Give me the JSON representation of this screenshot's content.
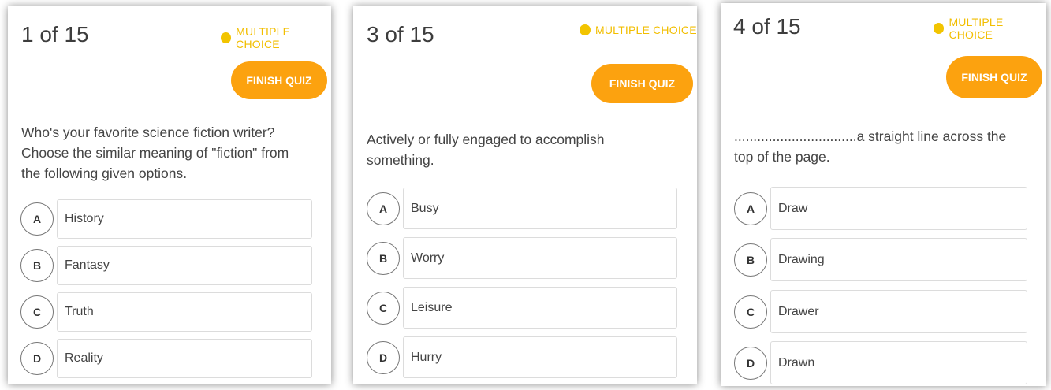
{
  "cards": [
    {
      "counter": "1 of 15",
      "badge": "MULTIPLE CHOICE",
      "finish_label": "FINISH QUIZ",
      "question_lines": [
        "Who's your favorite science fiction writer?",
        "Choose the similar meaning of \"fiction\" from",
        "the following given options."
      ],
      "options": [
        {
          "letter": "A",
          "text": "History"
        },
        {
          "letter": "B",
          "text": "Fantasy"
        },
        {
          "letter": "C",
          "text": "Truth"
        },
        {
          "letter": "D",
          "text": "Reality"
        }
      ]
    },
    {
      "counter": "3 of 15",
      "badge": "MULTIPLE CHOICE",
      "finish_label": "FINISH QUIZ",
      "question_lines": [
        "Actively or fully engaged to accomplish",
        "something."
      ],
      "options": [
        {
          "letter": "A",
          "text": "Busy"
        },
        {
          "letter": "B",
          "text": "Worry"
        },
        {
          "letter": "C",
          "text": "Leisure"
        },
        {
          "letter": "D",
          "text": "Hurry"
        }
      ]
    },
    {
      "counter": "4 of 15",
      "badge": "MULTIPLE CHOICE",
      "finish_label": "FINISH QUIZ",
      "question_lines": [
        "................................a straight line across the",
        "top of the page."
      ],
      "options": [
        {
          "letter": "A",
          "text": "Draw"
        },
        {
          "letter": "B",
          "text": "Drawing"
        },
        {
          "letter": "C",
          "text": "Drawer"
        },
        {
          "letter": "D",
          "text": "Drawn"
        }
      ]
    }
  ],
  "colors": {
    "finish_button": "#fca20f",
    "badge_dot": "#f2c400",
    "badge_text": "#f2be00"
  }
}
